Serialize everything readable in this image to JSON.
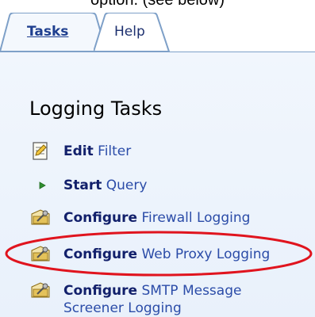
{
  "caption": "option. (see below)",
  "tabs": {
    "tasks_label": "Tasks",
    "help_label": "Help"
  },
  "section": {
    "title": "Logging Tasks"
  },
  "tasks": [
    {
      "verb": "Edit",
      "object": "Filter",
      "icon": "edit-filter-icon"
    },
    {
      "verb": "Start",
      "object": "Query",
      "icon": "play-arrow-icon"
    },
    {
      "verb": "Configure",
      "object": "Firewall Logging",
      "icon": "configure-icon"
    },
    {
      "verb": "Configure",
      "object": "Web Proxy Logging",
      "icon": "configure-icon"
    },
    {
      "verb": "Configure",
      "object": "SMTP Message",
      "object_line2": "Screener Logging",
      "icon": "configure-icon"
    }
  ],
  "colors": {
    "accent_oval": "#e0141e",
    "link_verb": "#12206b",
    "link_object": "#2b4ca8",
    "panel_bg": "#eef4fc",
    "tab_border": "#7ea0c8"
  }
}
